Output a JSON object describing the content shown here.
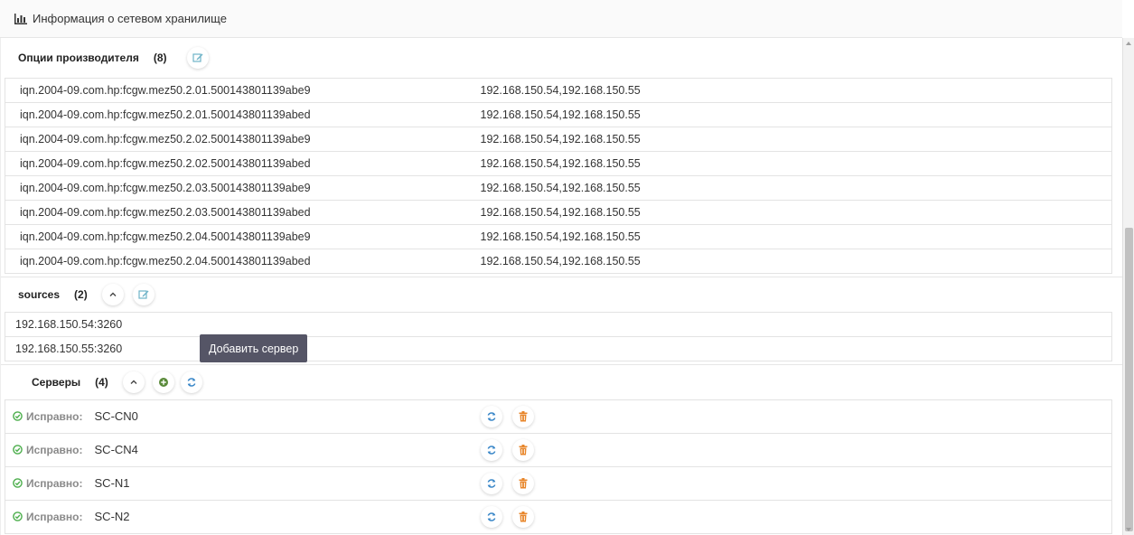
{
  "header": {
    "title": "Информация о сетевом хранилище",
    "icon": "bar-chart-icon"
  },
  "vendor_options": {
    "label": "Опции производителя",
    "count": "(8)",
    "rows": [
      {
        "name": "iqn.2004-09.com.hp:fcgw.mez50.2.01.500143801139abe9",
        "ips": "192.168.150.54,192.168.150.55"
      },
      {
        "name": "iqn.2004-09.com.hp:fcgw.mez50.2.01.500143801139abed",
        "ips": "192.168.150.54,192.168.150.55"
      },
      {
        "name": "iqn.2004-09.com.hp:fcgw.mez50.2.02.500143801139abe9",
        "ips": "192.168.150.54,192.168.150.55"
      },
      {
        "name": "iqn.2004-09.com.hp:fcgw.mez50.2.02.500143801139abed",
        "ips": "192.168.150.54,192.168.150.55"
      },
      {
        "name": "iqn.2004-09.com.hp:fcgw.mez50.2.03.500143801139abe9",
        "ips": "192.168.150.54,192.168.150.55"
      },
      {
        "name": "iqn.2004-09.com.hp:fcgw.mez50.2.03.500143801139abed",
        "ips": "192.168.150.54,192.168.150.55"
      },
      {
        "name": "iqn.2004-09.com.hp:fcgw.mez50.2.04.500143801139abe9",
        "ips": "192.168.150.54,192.168.150.55"
      },
      {
        "name": "iqn.2004-09.com.hp:fcgw.mez50.2.04.500143801139abed",
        "ips": "192.168.150.54,192.168.150.55"
      }
    ]
  },
  "sources": {
    "label": "sources",
    "count": "(2)",
    "rows": [
      "192.168.150.54:3260",
      "192.168.150.55:3260"
    ]
  },
  "servers": {
    "label": "Серверы",
    "count": "(4)",
    "tooltip": "Добавить сервер",
    "rows": [
      {
        "status": "Исправно:",
        "name": "SC-CN0"
      },
      {
        "status": "Исправно:",
        "name": "SC-CN4"
      },
      {
        "status": "Исправно:",
        "name": "SC-N1"
      },
      {
        "status": "Исправно:",
        "name": "SC-N2"
      }
    ]
  },
  "colors": {
    "ok_green": "#4cae4c",
    "refresh_blue": "#3a87c8",
    "delete_orange": "#e8862a",
    "add_green": "#5a8a3a",
    "edit_teal": "#6fb3c8",
    "tooltip_bg": "#555566"
  }
}
